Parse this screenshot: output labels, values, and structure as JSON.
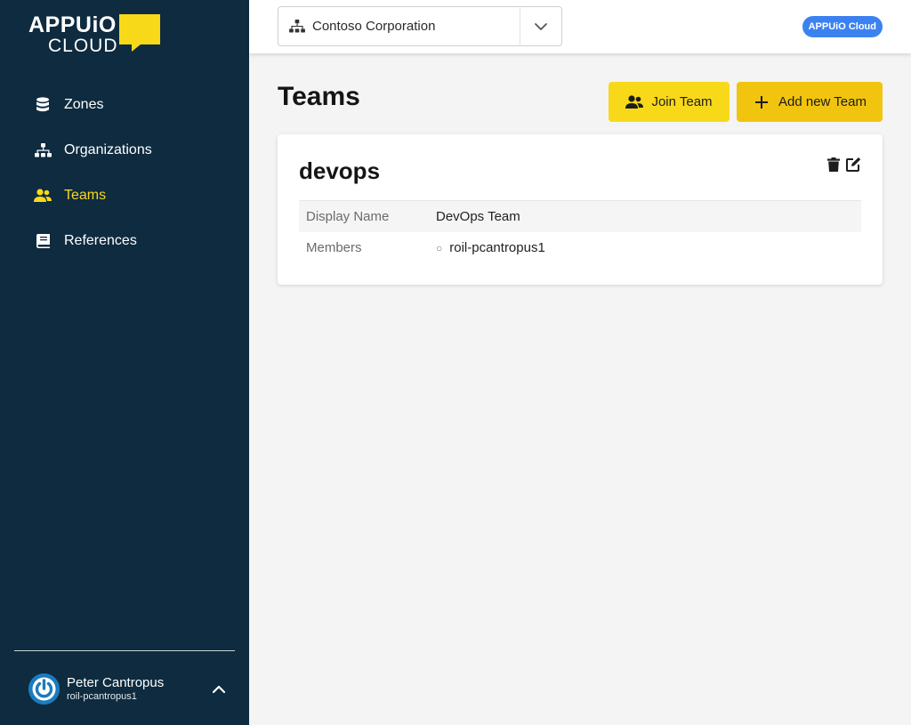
{
  "app": {
    "logo_top": "APPUiO",
    "logo_bottom": "CLOUD",
    "badge": "APPUiO Cloud",
    "colors": {
      "sidebar": "#0e2b3f",
      "accent": "#f8d91a",
      "badge": "#3b82f0"
    }
  },
  "sidebar": {
    "items": [
      {
        "label": "Zones",
        "icon": "database-icon",
        "active": false
      },
      {
        "label": "Organizations",
        "icon": "sitemap-icon",
        "active": false
      },
      {
        "label": "Teams",
        "icon": "users-icon",
        "active": true
      },
      {
        "label": "References",
        "icon": "book-icon",
        "active": false
      }
    ]
  },
  "user": {
    "name": "Peter Cantropus",
    "login": "roil-pcantropus1"
  },
  "topbar": {
    "org_selected": "Contoso Corporation"
  },
  "main": {
    "title": "Teams",
    "join_label": "Join Team",
    "add_label": "Add new Team",
    "team": {
      "name": "devops",
      "display_name_label": "Display Name",
      "display_name": "DevOps Team",
      "members_label": "Members",
      "members": [
        "roil-pcantropus1"
      ]
    }
  }
}
